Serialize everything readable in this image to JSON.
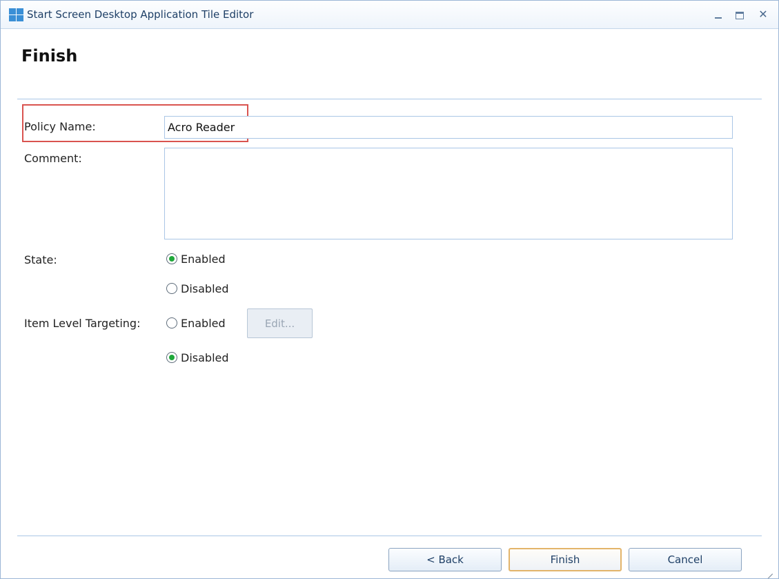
{
  "window": {
    "title": "Start Screen Desktop Application Tile Editor",
    "minimize_glyph": "",
    "maximize_glyph": "",
    "close_glyph": "✕",
    "icon": "windows-logo-icon"
  },
  "page": {
    "heading": "Finish"
  },
  "form": {
    "policy_name_label": "Policy Name:",
    "policy_name_value": "Acro Reader",
    "comment_label": "Comment:",
    "comment_value": "",
    "state_label": "State:",
    "state_enabled_label": "Enabled",
    "state_disabled_label": "Disabled",
    "state_selected": "Enabled",
    "ilt_label": "Item Level Targeting:",
    "ilt_enabled_label": "Enabled",
    "ilt_disabled_label": "Disabled",
    "ilt_selected": "Disabled",
    "edit_button_label": "Edit..."
  },
  "footer": {
    "back_label": "< Back",
    "finish_label": "Finish",
    "cancel_label": "Cancel"
  },
  "colors": {
    "highlight_border": "#d9534f",
    "radio_checked": "#1fa83a",
    "separator": "#a9c6e6",
    "primary_button_border": "#e3b46a"
  }
}
